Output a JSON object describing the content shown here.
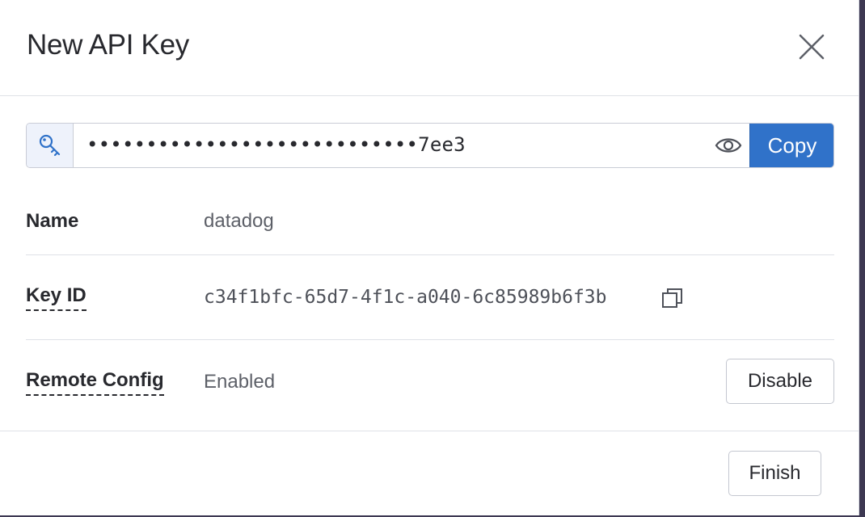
{
  "modal": {
    "title": "New API Key"
  },
  "api_key": {
    "masked_value": "••••••••••••••••••••••••••••7ee3",
    "copy_label": "Copy",
    "key_icon": "key-icon",
    "reveal_icon": "eye-icon"
  },
  "details": {
    "name_label": "Name",
    "name_value": "datadog",
    "key_id_label": "Key ID",
    "key_id_value": "c34f1bfc-65d7-4f1c-a040-6c85989b6f3b",
    "key_id_copy_icon": "copy-icon",
    "remote_config_label": "Remote Config",
    "remote_config_value": "Enabled",
    "disable_label": "Disable"
  },
  "footer": {
    "finish_label": "Finish"
  },
  "colors": {
    "primary": "#3072c9",
    "text": "#28292e",
    "muted": "#5d6068",
    "border": "#c9ccd6"
  }
}
